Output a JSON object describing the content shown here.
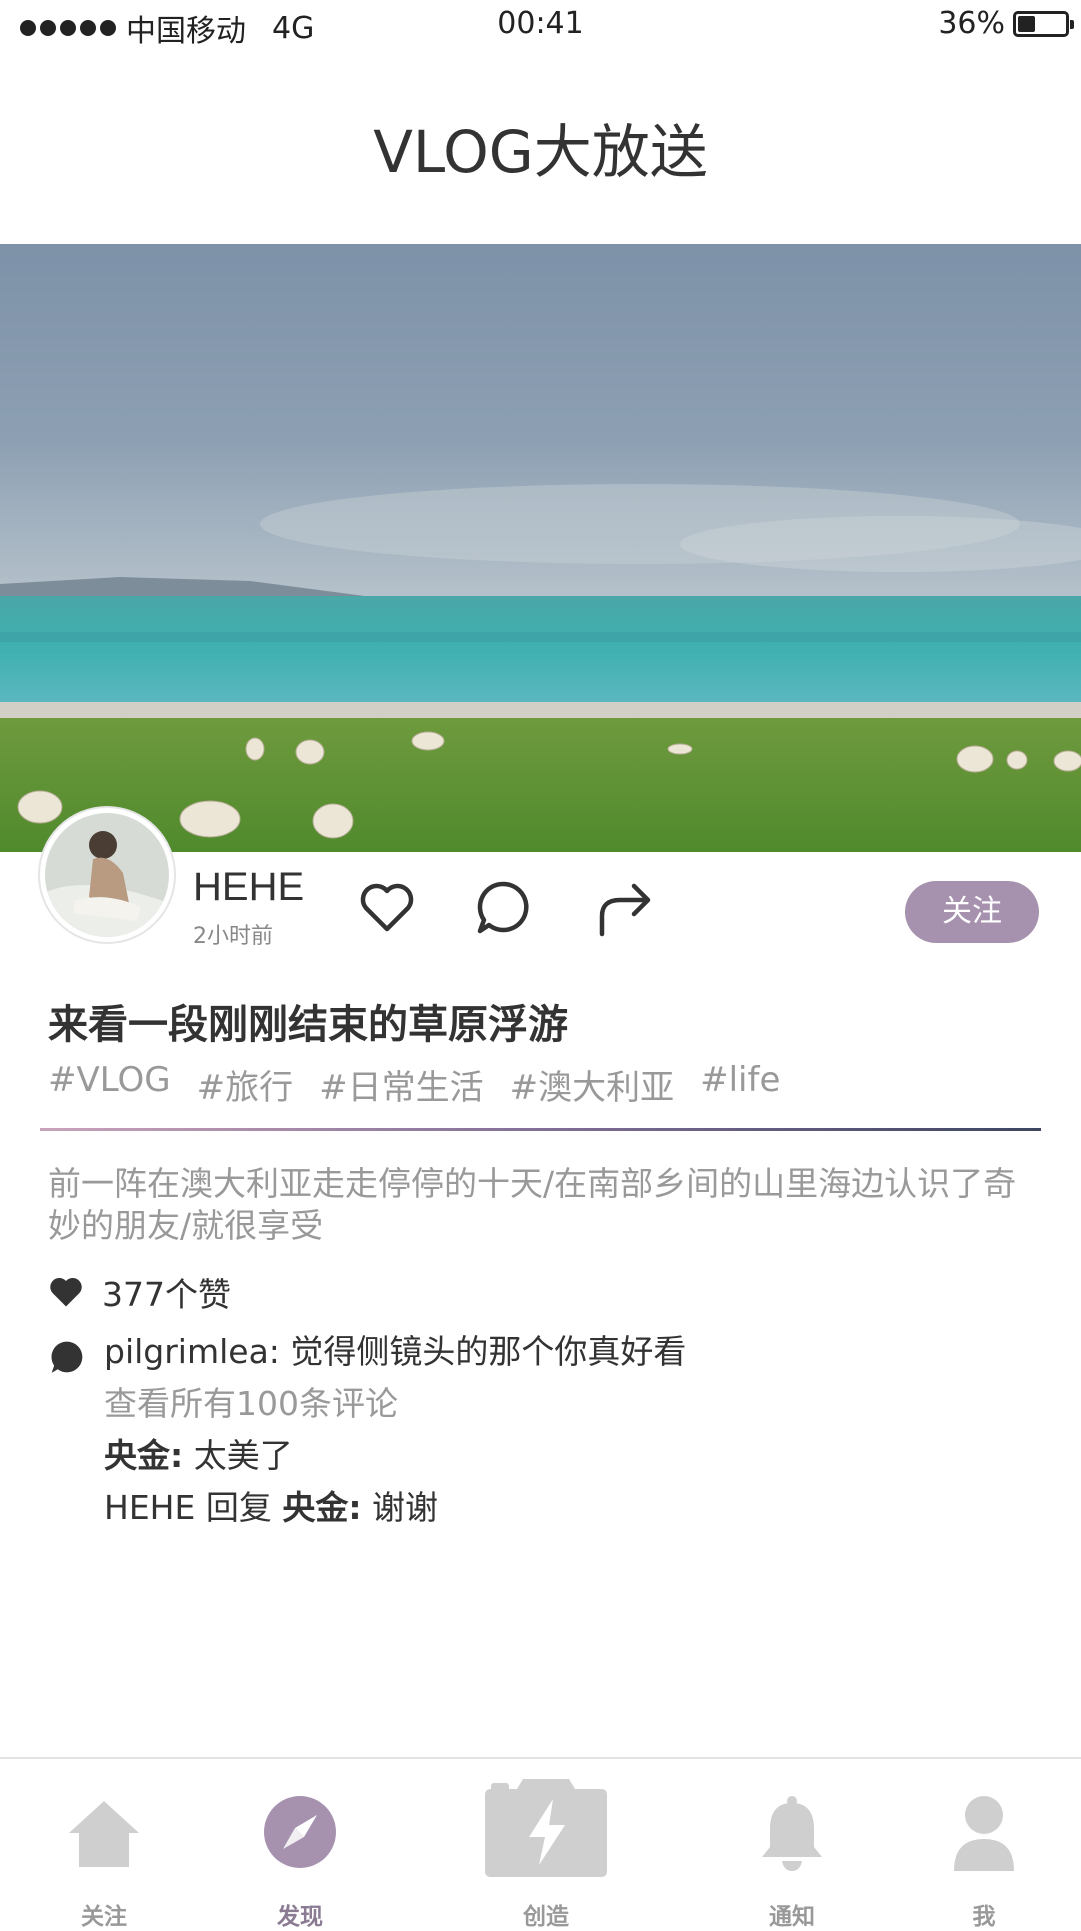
{
  "status_bar": {
    "carrier": "中国移动",
    "network": "4G",
    "time": "00:41",
    "battery": "36%",
    "battery_level": 0.36
  },
  "page": {
    "title": "VLOG大放送"
  },
  "post": {
    "username": "HEHE",
    "time_ago": "2小时前",
    "follow_label": "关注",
    "title": "来看一段刚刚结束的草原浮游",
    "tags": [
      "#VLOG",
      "#旅行",
      "#日常生活",
      "#澳大利亚",
      "#life"
    ],
    "description": "前一阵在澳大利亚走走停停的十天/在南部乡间的山里海边认识了奇妙的朋友/就很享受",
    "likes": "377个赞",
    "comments": {
      "first_user": "pilgrimlea:",
      "first_text": " 觉得侧镜头的那个你真好看",
      "view_all": "查看所有100条评论",
      "second_user": "央金:",
      "second_text": " 太美了",
      "reply_user": "HEHE",
      "reply_word": " 回复 ",
      "reply_target": "央金:",
      "reply_text": " 谢谢"
    }
  },
  "tabbar": {
    "items": [
      {
        "label": "关注",
        "icon": "home-icon"
      },
      {
        "label": "发现",
        "icon": "compass-icon"
      },
      {
        "label": "创造",
        "icon": "camera-icon"
      },
      {
        "label": "通知",
        "icon": "bell-icon"
      },
      {
        "label": "我",
        "icon": "user-icon"
      }
    ],
    "active_index": 1
  },
  "colors": {
    "accent": "#a692ae",
    "muted_text": "#999999",
    "tab_icon": "#cfcfcf"
  }
}
